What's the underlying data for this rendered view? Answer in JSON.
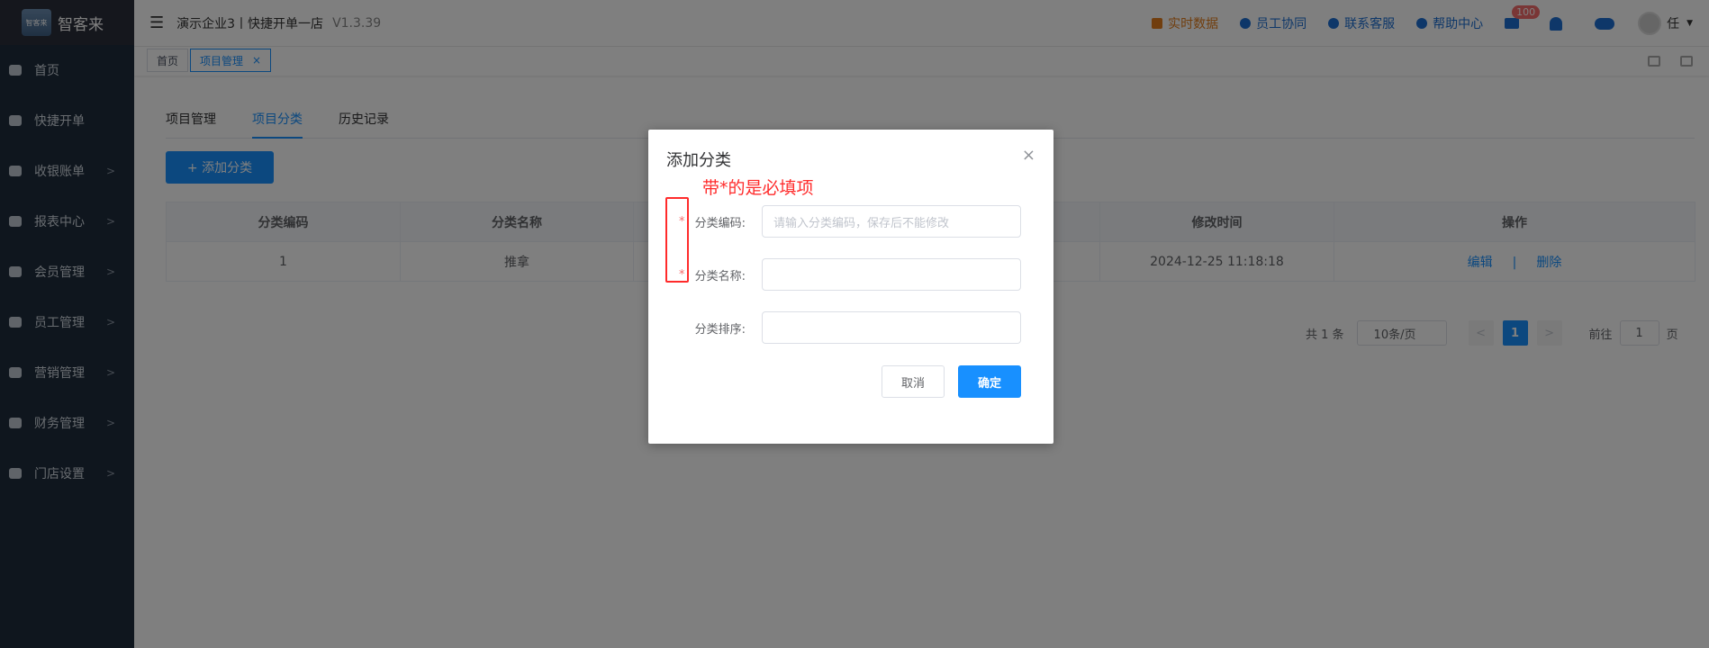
{
  "logo": {
    "small": "智客来",
    "name": "智客来"
  },
  "sidebar": {
    "items": [
      {
        "label": "首页",
        "arrow": ""
      },
      {
        "label": "快捷开单",
        "arrow": ""
      },
      {
        "label": "收银账单",
        "arrow": ">"
      },
      {
        "label": "报表中心",
        "arrow": ">"
      },
      {
        "label": "会员管理",
        "arrow": ">"
      },
      {
        "label": "员工管理",
        "arrow": ">"
      },
      {
        "label": "营销管理",
        "arrow": ">"
      },
      {
        "label": "财务管理",
        "arrow": ">"
      },
      {
        "label": "门店设置",
        "arrow": ">"
      }
    ]
  },
  "header": {
    "company": "演示企业3丨快捷开单一店",
    "version": "V1.3.39",
    "links": [
      "实时数据",
      "员工协同",
      "联系客服",
      "帮助中心"
    ],
    "message_count": "100",
    "user": "任"
  },
  "tagbar": {
    "tags": [
      "首页",
      "项目管理"
    ],
    "close": "×"
  },
  "tabs": [
    "项目管理",
    "项目分类",
    "历史记录"
  ],
  "add_button": "+ 添加分类",
  "table": {
    "headers": [
      "分类编码",
      "分类名称",
      "",
      "",
      "修改时间",
      "操作"
    ],
    "row": {
      "code": "1",
      "name": "推拿",
      "modified": "2024-12-25 11:18:18",
      "edit": "编辑",
      "sep": "|",
      "delete": "删除"
    }
  },
  "pager": {
    "total": "共 1 条",
    "size": "10条/页",
    "page": "1",
    "goto": "前往",
    "goto_value": "1",
    "unit": "页",
    "prev": "<",
    "next": ">"
  },
  "modal": {
    "title": "添加分类",
    "close": "×",
    "note": "带*的是必填项",
    "fields": [
      {
        "star": "*",
        "label": "分类编码:",
        "placeholder": "请输入分类编码，保存后不能修改"
      },
      {
        "star": "*",
        "label": "分类名称:",
        "placeholder": ""
      },
      {
        "star": "",
        "label": "分类排序:",
        "placeholder": ""
      }
    ],
    "cancel": "取消",
    "confirm": "确定"
  },
  "colors": {
    "primary": "#1890ff",
    "sidebar": "#1f2d3d",
    "annotation": "#ff2b2b"
  }
}
